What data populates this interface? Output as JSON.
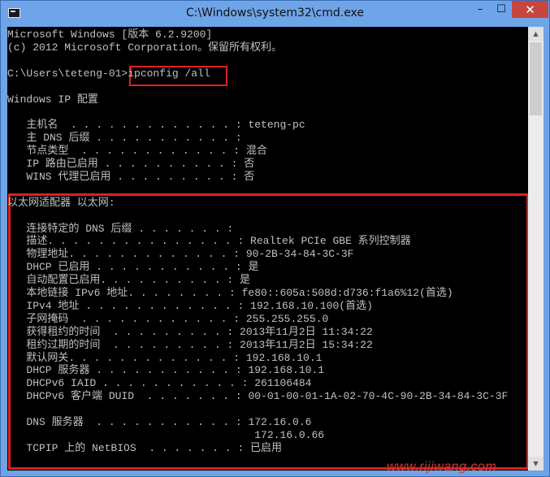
{
  "window": {
    "title": "C:\\Windows\\system32\\cmd.exe",
    "minimize_glyph": "–",
    "maximize_glyph": "☐",
    "close_glyph": "✕"
  },
  "lines": [
    "Microsoft Windows [版本 6.2.9200]",
    "(c) 2012 Microsoft Corporation。保留所有权利。",
    "",
    "C:\\Users\\teteng-01>ipconfig /all",
    "",
    "Windows IP 配置",
    "",
    "   主机名  . . . . . . . . . . . . . : teteng-pc",
    "   主 DNS 后缀 . . . . . . . . . . . :",
    "   节点类型  . . . . . . . . . . . . : 混合",
    "   IP 路由已启用 . . . . . . . . . . : 否",
    "   WINS 代理已启用 . . . . . . . . . : 否",
    "",
    "以太网适配器 以太网:",
    "",
    "   连接特定的 DNS 后缀 . . . . . . . :",
    "   描述. . . . . . . . . . . . . . . : Realtek PCIe GBE 系列控制器",
    "   物理地址. . . . . . . . . . . . . : 90-2B-34-84-3C-3F",
    "   DHCP 已启用 . . . . . . . . . . . : 是",
    "   自动配置已启用. . . . . . . . . . : 是",
    "   本地链接 IPv6 地址. . . . . . . . : fe80::605a:508d:d736:f1a6%12(首选)",
    "   IPv4 地址 . . . . . . . . . . . . : 192.168.10.100(首选)",
    "   子网掩码  . . . . . . . . . . . . : 255.255.255.0",
    "   获得租约的时间  . . . . . . . . . : 2013年11月2日 11:34:22",
    "   租约过期的时间  . . . . . . . . . : 2013年11月2日 15:34:22",
    "   默认网关. . . . . . . . . . . . . : 192.168.10.1",
    "   DHCP 服务器 . . . . . . . . . . . : 192.168.10.1",
    "   DHCPv6 IAID . . . . . . . . . . . : 261106484",
    "   DHCPv6 客户端 DUID  . . . . . . . : 00-01-00-01-1A-02-70-4C-90-2B-34-84-3C-3F",
    "",
    "   DNS 服务器  . . . . . . . . . . . : 172.16.0.6",
    "                                       172.16.0.66",
    "   TCPIP 上的 NetBIOS  . . . . . . . : 已启用"
  ],
  "watermark": "www.rijiwang.com"
}
